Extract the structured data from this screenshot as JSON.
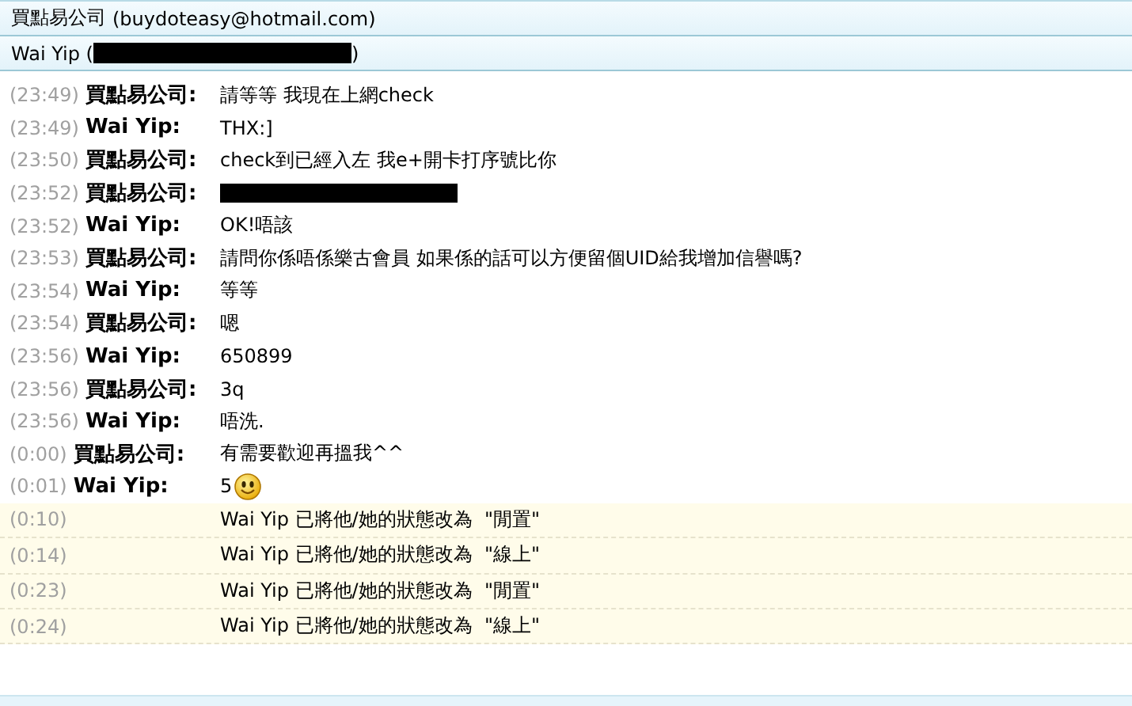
{
  "header": {
    "contact": {
      "name": "買點易公司",
      "email": "(buydoteasy@hotmail.com)"
    },
    "self": {
      "prefix": "Wai Yip (",
      "suffix": ")",
      "redacted": true
    }
  },
  "messages": [
    {
      "kind": "message",
      "time": "(23:49)",
      "sender": "買點易公司:",
      "text": "請等等 我現在上網check"
    },
    {
      "kind": "message",
      "time": "(23:49)",
      "sender": "Wai Yip:",
      "text": "THX:]"
    },
    {
      "kind": "message",
      "time": "(23:50)",
      "sender": "買點易公司:",
      "text": "check到已經入左 我e+開卡打序號比你"
    },
    {
      "kind": "message",
      "time": "(23:52)",
      "sender": "買點易公司:",
      "redacted": true
    },
    {
      "kind": "message",
      "time": "(23:52)",
      "sender": "Wai Yip:",
      "text": "OK!唔該"
    },
    {
      "kind": "message",
      "time": "(23:53)",
      "sender": "買點易公司:",
      "text": "請問你係唔係樂古會員 如果係的話可以方便留個UID給我增加信譽嗎?"
    },
    {
      "kind": "message",
      "time": "(23:54)",
      "sender": "Wai Yip:",
      "text": "等等"
    },
    {
      "kind": "message",
      "time": "(23:54)",
      "sender": "買點易公司:",
      "text": "嗯"
    },
    {
      "kind": "message",
      "time": "(23:56)",
      "sender": "Wai Yip:",
      "text": "650899"
    },
    {
      "kind": "message",
      "time": "(23:56)",
      "sender": "買點易公司:",
      "text": "3q"
    },
    {
      "kind": "message",
      "time": "(23:56)",
      "sender": "Wai Yip:",
      "text": "唔洗."
    },
    {
      "kind": "message",
      "time": "(0:00)",
      "sender": "買點易公司:",
      "text": "有需要歡迎再搵我^^"
    },
    {
      "kind": "message",
      "time": "(0:01)",
      "sender": "Wai Yip:",
      "text": "5",
      "emoticon": true
    },
    {
      "kind": "status",
      "time": "(0:10)",
      "text": "Wai Yip 已將他/她的狀態改為  \"閒置\""
    },
    {
      "kind": "status",
      "time": "(0:14)",
      "text": "Wai Yip 已將他/她的狀態改為  \"線上\""
    },
    {
      "kind": "status",
      "time": "(0:23)",
      "text": "Wai Yip 已將他/她的狀態改為  \"閒置\""
    },
    {
      "kind": "status",
      "time": "(0:24)",
      "text": "Wai Yip 已將他/她的狀態改為  \"線上\""
    }
  ]
}
